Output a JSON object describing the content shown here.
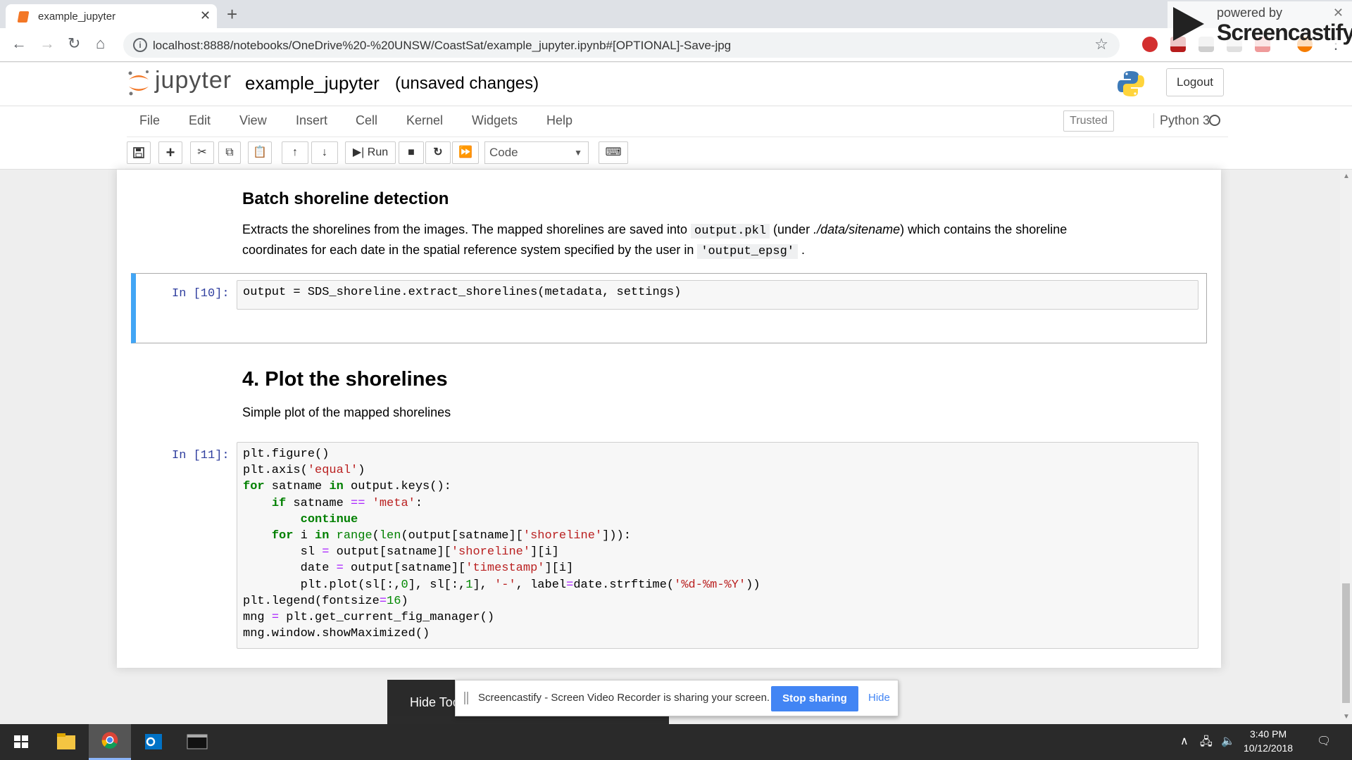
{
  "browser": {
    "tab_title": "example_jupyter",
    "url": "localhost:8888/notebooks/OneDrive%20-%20UNSW/CoastSat/example_jupyter.ipynb#[OPTIONAL]-Save-jpg"
  },
  "screencastify_badge": {
    "powered_by": "powered by",
    "name": "Screencastify"
  },
  "jupyter": {
    "logo_text": "jupyter",
    "notebook_title": "example_jupyter",
    "save_status": "(unsaved changes)",
    "logout_label": "Logout",
    "menu": [
      "File",
      "Edit",
      "View",
      "Insert",
      "Cell",
      "Kernel",
      "Widgets",
      "Help"
    ],
    "trusted_label": "Trusted",
    "kernel_name": "Python 3",
    "run_label": "Run",
    "cell_type": "Code"
  },
  "notebook": {
    "section1_heading": "Batch shoreline detection",
    "section1_text_a": "Extracts the shorelines from the images. The mapped shorelines are saved into ",
    "section1_code_a": "output.pkl",
    "section1_text_b": " (under ",
    "section1_text_em": "./data/sitename",
    "section1_text_c": ") which contains the shoreline coordinates for each date in the spatial reference system specified by the user in ",
    "section1_code_b": "'output_epsg'",
    "section1_text_d": " .",
    "cell10_prompt": "In [10]:",
    "cell10_code": "output = SDS_shoreline.extract_shorelines(metadata, settings)",
    "section2_heading": "4. Plot the shorelines",
    "section2_text": "Simple plot of the mapped shorelines",
    "cell11_prompt": "In [11]:"
  },
  "share_bar": {
    "hide_tools": "Hide Tools",
    "message": "Screencastify - Screen Video Recorder is sharing your screen.",
    "stop_label": "Stop sharing",
    "hide_label": "Hide"
  },
  "taskbar": {
    "time": "3:40 PM",
    "date": "10/12/2018"
  }
}
